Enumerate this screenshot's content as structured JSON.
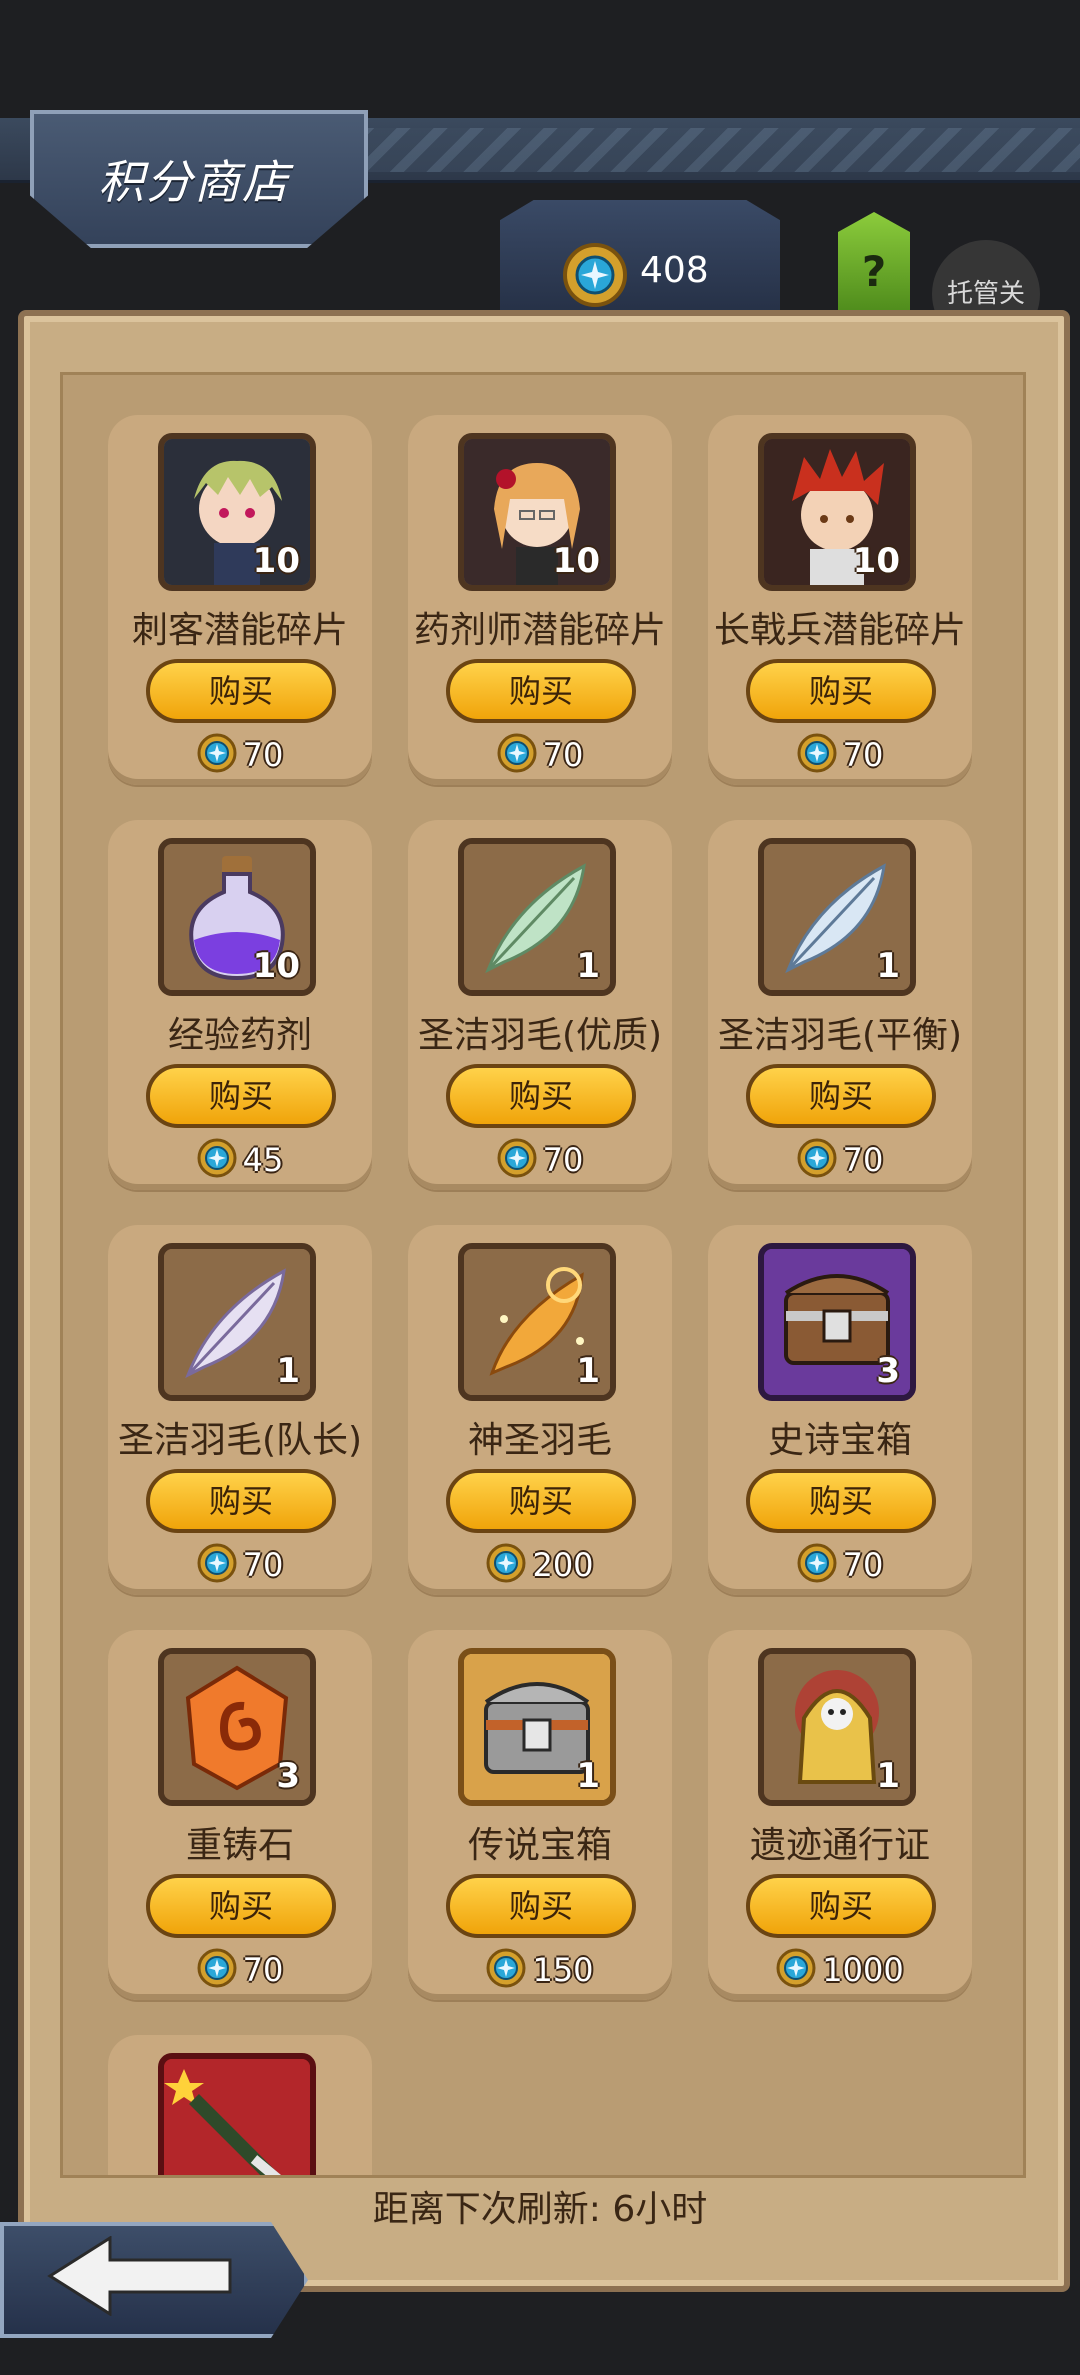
{
  "header": {
    "title": "积分商店",
    "currency_value": "408",
    "help_label": "?",
    "auto_label": "托管关"
  },
  "shop": {
    "items": [
      {
        "name": "刺客潜能碎片",
        "qty": "10",
        "buy": "购买",
        "price": "70",
        "icon": "assassin-portrait-icon"
      },
      {
        "name": "药剂师潜能碎片",
        "qty": "10",
        "buy": "购买",
        "price": "70",
        "icon": "alchemist-portrait-icon"
      },
      {
        "name": "长戟兵潜能碎片",
        "qty": "10",
        "buy": "购买",
        "price": "70",
        "icon": "halberdier-portrait-icon"
      },
      {
        "name": "经验药剂",
        "qty": "10",
        "buy": "购买",
        "price": "45",
        "icon": "potion-icon"
      },
      {
        "name": "圣洁羽毛(优质)",
        "qty": "1",
        "buy": "购买",
        "price": "70",
        "icon": "green-feather-icon"
      },
      {
        "name": "圣洁羽毛(平衡)",
        "qty": "1",
        "buy": "购买",
        "price": "70",
        "icon": "blue-feather-icon"
      },
      {
        "name": "圣洁羽毛(队长)",
        "qty": "1",
        "buy": "购买",
        "price": "70",
        "icon": "purple-feather-icon"
      },
      {
        "name": "神圣羽毛",
        "qty": "1",
        "buy": "购买",
        "price": "200",
        "icon": "golden-feather-icon"
      },
      {
        "name": "史诗宝箱",
        "qty": "3",
        "buy": "购买",
        "price": "70",
        "icon": "epic-chest-icon"
      },
      {
        "name": "重铸石",
        "qty": "3",
        "buy": "购买",
        "price": "70",
        "icon": "reforge-stone-icon"
      },
      {
        "name": "传说宝箱",
        "qty": "1",
        "buy": "购买",
        "price": "150",
        "icon": "legendary-chest-icon"
      },
      {
        "name": "遗迹通行证",
        "qty": "1",
        "buy": "购买",
        "price": "1000",
        "icon": "relic-pass-icon"
      },
      {
        "name": "",
        "qty": "",
        "buy": "",
        "price": "",
        "icon": "weapon-card-icon"
      }
    ]
  },
  "footer": {
    "refresh_text": "距离下次刷新: 6小时"
  }
}
